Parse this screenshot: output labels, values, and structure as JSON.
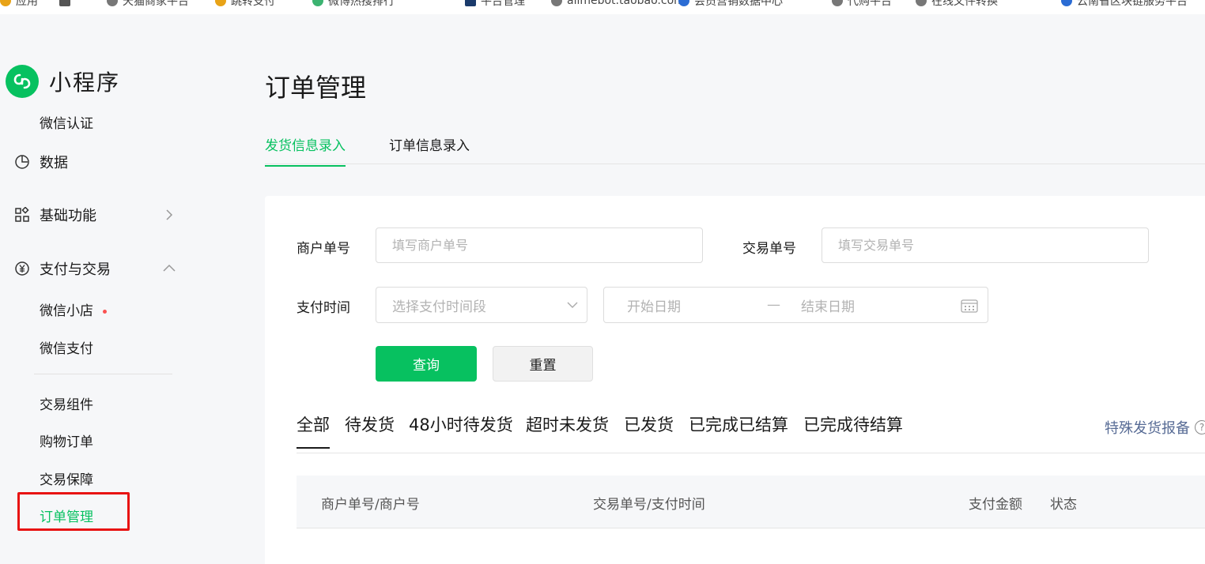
{
  "bookmarks": [
    "应用",
    "",
    "天猫商家平台",
    "跳转支付",
    "微博热搜排行",
    "平台管理",
    "alimebot.taobao.com",
    "会员营销数据中心",
    "代购平台",
    "在线文件转换",
    "云南省区块链服务平台"
  ],
  "sidebar": {
    "app_name": "小程序",
    "items": [
      {
        "label": "微信认证"
      },
      {
        "label": "数据"
      },
      {
        "label": "基础功能"
      },
      {
        "label": "支付与交易"
      }
    ],
    "pay_sub": [
      {
        "label": "微信小店"
      },
      {
        "label": "微信支付"
      }
    ],
    "trade_sub": [
      {
        "label": "交易组件"
      },
      {
        "label": "购物订单"
      },
      {
        "label": "交易保障"
      },
      {
        "label": "订单管理"
      }
    ]
  },
  "main": {
    "title": "订单管理",
    "tabs": [
      {
        "label": "发货信息录入"
      },
      {
        "label": "订单信息录入"
      }
    ],
    "form": {
      "merchant_no_label": "商户单号",
      "merchant_no_placeholder": "填写商户单号",
      "trade_no_label": "交易单号",
      "trade_no_placeholder": "填写交易单号",
      "pay_time_label": "支付时间",
      "pay_time_select": "选择支付时间段",
      "start_date": "开始日期",
      "date_sep": "—",
      "end_date": "结束日期",
      "query_button": "查询",
      "reset_button": "重置"
    },
    "status_tabs": [
      {
        "label": "全部"
      },
      {
        "label": "待发货"
      },
      {
        "label": "48小时待发货"
      },
      {
        "label": "超时未发货"
      },
      {
        "label": "已发货"
      },
      {
        "label": "已完成已结算"
      },
      {
        "label": "已完成待结算"
      }
    ],
    "report_link": "特殊发货报备",
    "table_headers": [
      "商户单号/商户号",
      "交易单号/支付时间",
      "支付金额",
      "状态"
    ]
  },
  "colors": {
    "brand_green": "#07c160",
    "highlight_red": "#e81313",
    "link_blue": "#576b95"
  }
}
